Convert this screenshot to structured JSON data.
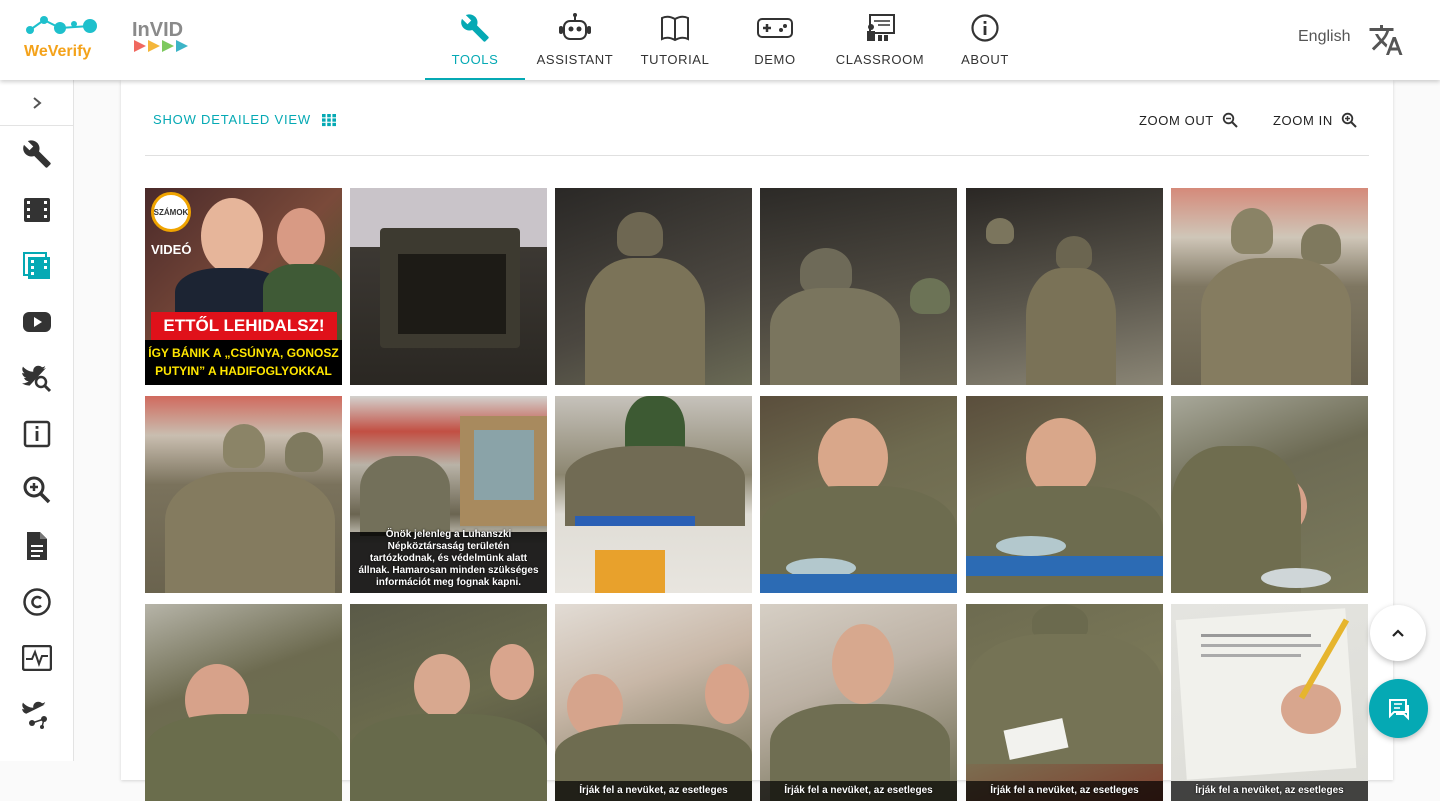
{
  "header": {
    "brand_weverify": "WeVerify",
    "brand_invid": "InVID",
    "nav": [
      {
        "label": "TOOLS",
        "icon": "wrench-icon",
        "active": true
      },
      {
        "label": "ASSISTANT",
        "icon": "robot-icon",
        "active": false
      },
      {
        "label": "TUTORIAL",
        "icon": "book-icon",
        "active": false
      },
      {
        "label": "DEMO",
        "icon": "gamepad-icon",
        "active": false
      },
      {
        "label": "CLASSROOM",
        "icon": "classroom-icon",
        "active": false
      },
      {
        "label": "ABOUT",
        "icon": "info-icon",
        "active": false
      }
    ],
    "language": "English"
  },
  "sidebar": {
    "items": [
      "wrench-icon",
      "film-icon",
      "keyframes-icon",
      "youtube-icon",
      "twitter-search-icon",
      "info-box-icon",
      "zoom-in-icon",
      "document-icon",
      "copyright-icon",
      "analytics-icon",
      "twitter-network-icon"
    ],
    "active_index": 2
  },
  "toolbar": {
    "detailed_view_label": "SHOW DETAILED VIEW",
    "zoom_out_label": "ZOOM OUT",
    "zoom_in_label": "ZOOM IN"
  },
  "thumbnail1": {
    "badge": "SZÁMOK",
    "tag": "VIDEÓ",
    "headline": "ETTŐL LEHIDALSZ!",
    "subline": "ÍGY BÁNIK A „CSÚNYA, GONOSZ PUTYIN” A HADIFOGLYOKKAL"
  },
  "captions": {
    "c8": "Önök jelenleg a Luhanszki Népköztársaság területén tartózkodnak, és védelmünk alatt állnak. Hamarosan minden szükséges információt meg fognak kapni.",
    "c15": "Írják fel a nevüket, az esetleges",
    "c16": "Írják fel a nevüket, az esetleges",
    "c17": "Írják fel a nevüket, az esetleges",
    "c18": "Írják fel a nevüket, az esetleges"
  },
  "colors": {
    "accent": "#05a9b4",
    "text": "#333333"
  }
}
